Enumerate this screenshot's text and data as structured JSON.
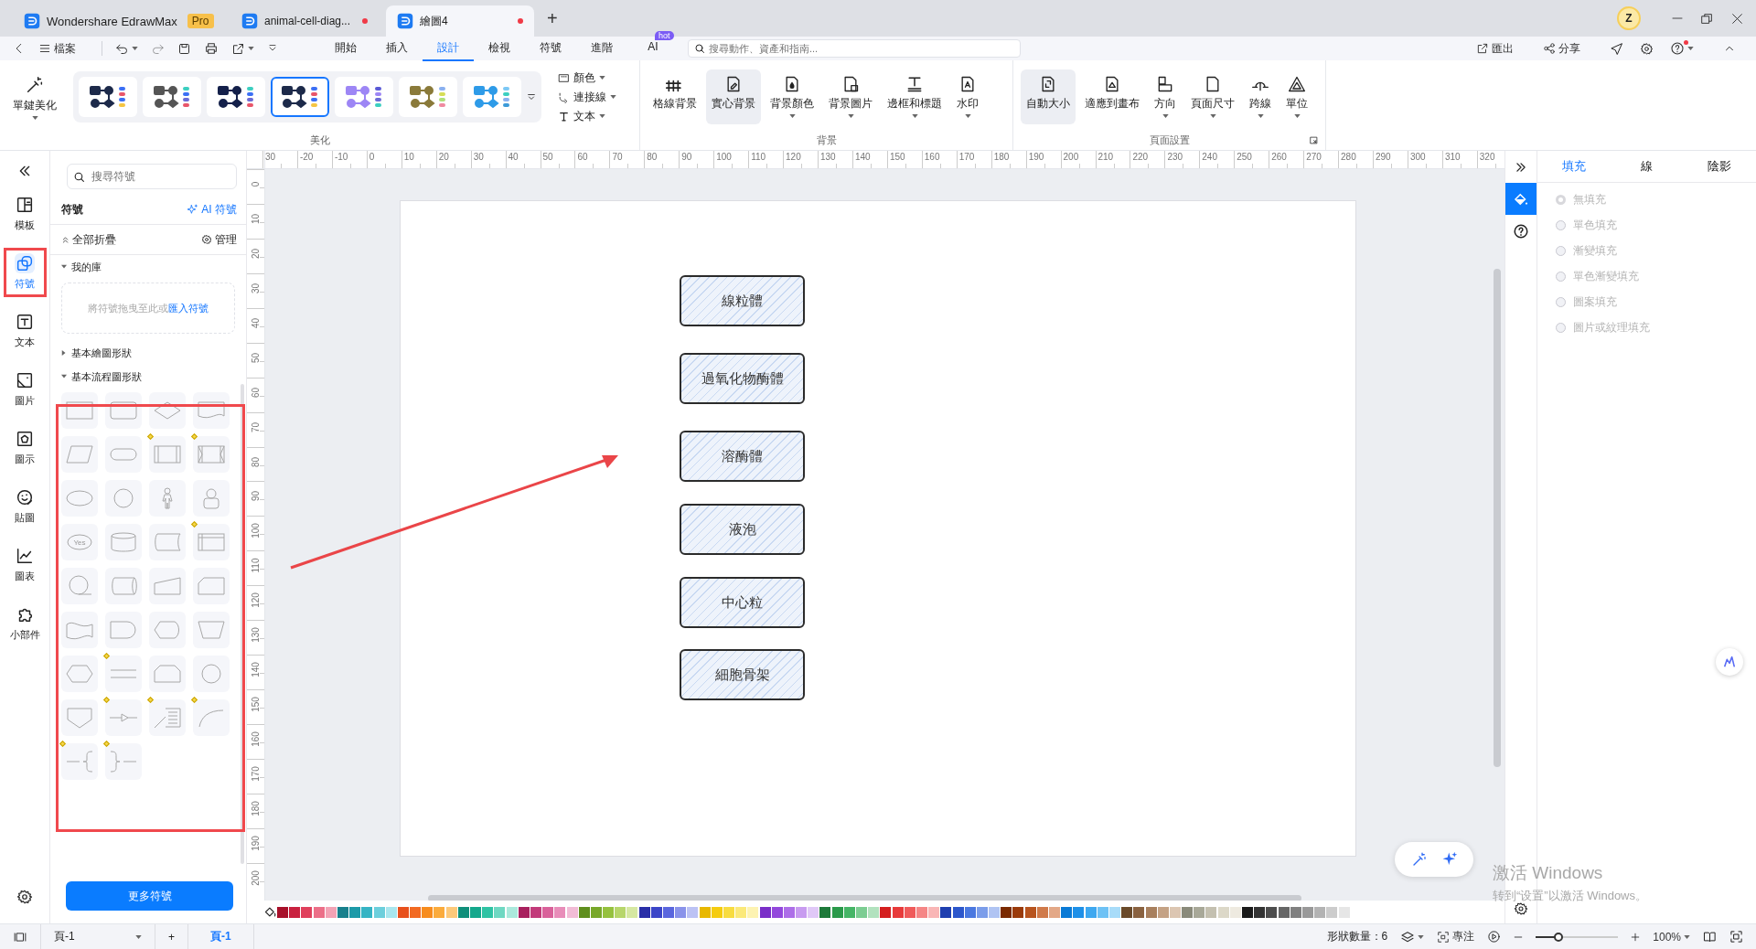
{
  "title_bar": {
    "tabs": [
      {
        "kind": "app",
        "label": "Wondershare EdrawMax",
        "badge": "Pro",
        "selected": false,
        "unsaved": false
      },
      {
        "kind": "doc",
        "label": "animal-cell-diag...",
        "selected": false,
        "unsaved": true
      },
      {
        "kind": "doc",
        "label": "繪圖4",
        "selected": true,
        "unsaved": true
      }
    ],
    "new_tab": "+",
    "avatar": "Z"
  },
  "menu_bar": {
    "file": "檔案",
    "tabs": [
      {
        "label": "開始",
        "selected": false
      },
      {
        "label": "插入",
        "selected": false
      },
      {
        "label": "設計",
        "selected": true
      },
      {
        "label": "檢視",
        "selected": false
      },
      {
        "label": "符號",
        "selected": false
      },
      {
        "label": "進階",
        "selected": false
      },
      {
        "label": "AI",
        "selected": false,
        "badge": "hot"
      }
    ],
    "search": {
      "placeholder": "搜尋動作、資產和指南..."
    },
    "export": "匯出",
    "share": "分享",
    "help_notification": true
  },
  "ribbon": {
    "groups": [
      {
        "kind": "beautify",
        "label": "美化",
        "beautify_button": "單鍵美化",
        "styles": [
          {
            "color": "#1d2a4a",
            "selected": false
          },
          {
            "color": "#555555",
            "selected": false
          },
          {
            "color": "#14204a",
            "selected": false
          },
          {
            "color": "#1d2a4a",
            "selected": true
          },
          {
            "color": "#9d86f5",
            "selected": false
          },
          {
            "color": "#8a7a3a",
            "selected": false
          },
          {
            "color": "#2e9be8",
            "selected": false
          }
        ],
        "format_menus": [
          {
            "label": "顏色"
          },
          {
            "label": "連接線"
          },
          {
            "label": "文本"
          }
        ]
      },
      {
        "kind": "buttons",
        "label": "背景",
        "buttons": [
          {
            "label": "格線背景",
            "caret": false,
            "selected": false
          },
          {
            "label": "實心背景",
            "caret": false,
            "selected": true
          },
          {
            "label": "背景顏色",
            "caret": true,
            "selected": false
          },
          {
            "label": "背景圖片",
            "caret": true,
            "selected": false
          },
          {
            "label": "邊框和標題",
            "caret": true,
            "selected": false
          },
          {
            "label": "水印",
            "caret": true,
            "selected": false
          }
        ]
      },
      {
        "kind": "buttons",
        "label": "頁面設置",
        "launcher": true,
        "buttons": [
          {
            "label": "自動大小",
            "caret": false,
            "selected": true
          },
          {
            "label": "適應到畫布",
            "caret": false,
            "selected": false
          },
          {
            "label": "方向",
            "caret": true,
            "selected": false
          },
          {
            "label": "頁面尺寸",
            "caret": true,
            "selected": false
          },
          {
            "label": "跨線",
            "caret": true,
            "selected": false
          },
          {
            "label": "單位",
            "caret": true,
            "selected": false
          }
        ]
      }
    ]
  },
  "left_rail": {
    "items": [
      {
        "label": "模板",
        "selected": false
      },
      {
        "label": "符號",
        "selected": true
      },
      {
        "label": "文本",
        "selected": false
      },
      {
        "label": "圖片",
        "selected": false
      },
      {
        "label": "圖示",
        "selected": false
      },
      {
        "label": "貼圖",
        "selected": false
      },
      {
        "label": "圖表",
        "selected": false
      },
      {
        "label": "小部件",
        "selected": false
      }
    ]
  },
  "symbol_panel": {
    "search": {
      "placeholder": "搜尋符號"
    },
    "title": "符號",
    "ai_link": "AI 符號",
    "collapse_all": "全部折疊",
    "manage": "管理",
    "libraries": [
      {
        "name": "我的庫",
        "expanded": true,
        "drop_hint": "將符號拖曳至此或",
        "import_link": "匯入符號"
      },
      {
        "name": "基本繪圖形狀",
        "expanded": false
      },
      {
        "name": "基本流程圖形狀",
        "expanded": true,
        "shapes": [
          {
            "kind": "rect"
          },
          {
            "kind": "rounded"
          },
          {
            "kind": "diamond"
          },
          {
            "kind": "document"
          },
          {
            "kind": "parallelogram"
          },
          {
            "kind": "terminator"
          },
          {
            "kind": "predefined",
            "handle": true
          },
          {
            "kind": "predefined-x",
            "handle": true
          },
          {
            "kind": "ellipse"
          },
          {
            "kind": "circle"
          },
          {
            "kind": "person"
          },
          {
            "kind": "user"
          },
          {
            "kind": "bubble",
            "label": "Yes"
          },
          {
            "kind": "cylinder"
          },
          {
            "kind": "stored"
          },
          {
            "kind": "window",
            "handle": true
          },
          {
            "kind": "tail-circle"
          },
          {
            "kind": "drum"
          },
          {
            "kind": "manual-input"
          },
          {
            "kind": "card"
          },
          {
            "kind": "tape"
          },
          {
            "kind": "delay"
          },
          {
            "kind": "display"
          },
          {
            "kind": "trapezoid"
          },
          {
            "kind": "hexagon"
          },
          {
            "kind": "lines",
            "handle": true
          },
          {
            "kind": "loop-limit"
          },
          {
            "kind": "circle"
          },
          {
            "kind": "offpage"
          },
          {
            "kind": "line-arrow",
            "handle": true
          },
          {
            "kind": "note",
            "handle": true
          },
          {
            "kind": "arc",
            "handle": true
          },
          {
            "kind": "brace-left",
            "handle": true
          },
          {
            "kind": "brace-right",
            "handle": true
          }
        ]
      }
    ],
    "more_button": "更多符號"
  },
  "canvas": {
    "rulers": {
      "horizontal": [
        "30",
        "-20",
        "-10",
        "0",
        "10",
        "20",
        "30",
        "40",
        "50",
        "60",
        "70",
        "80",
        "90",
        "100",
        "110",
        "120",
        "130",
        "140",
        "150",
        "160",
        "170",
        "180",
        "190",
        "200",
        "210",
        "220",
        "230",
        "240",
        "250",
        "260",
        "270",
        "280",
        "290",
        "300",
        "310",
        "320"
      ],
      "vertical": [
        "0",
        "10",
        "20",
        "30",
        "40",
        "50",
        "60",
        "70",
        "80",
        "90",
        "100",
        "110",
        "120",
        "130",
        "140",
        "150",
        "160",
        "170",
        "180",
        "190",
        "200"
      ]
    },
    "shapes": [
      {
        "label": "線粒體"
      },
      {
        "label": "過氧化物酶體"
      },
      {
        "label": "溶酶體"
      },
      {
        "label": "液泡"
      },
      {
        "label": "中心粒"
      },
      {
        "label": "細胞骨架"
      }
    ]
  },
  "palette": [
    {
      "color": "#a8102a"
    },
    {
      "color": "#c9213f"
    },
    {
      "color": "#e0405c"
    },
    {
      "color": "#ec6f88"
    },
    {
      "color": "#f3a3b5"
    },
    {
      "color": "#17808c"
    },
    {
      "color": "#1c9aa8"
    },
    {
      "color": "#35b4c4"
    },
    {
      "color": "#6ccfdc"
    },
    {
      "color": "#a8e6ee"
    },
    {
      "color": "#e8501c"
    },
    {
      "color": "#f26a22"
    },
    {
      "color": "#f78c1e"
    },
    {
      "color": "#fbab3c"
    },
    {
      "color": "#fdc97a"
    },
    {
      "color": "#0f8f7a"
    },
    {
      "color": "#14a88c"
    },
    {
      "color": "#2fc3a4"
    },
    {
      "color": "#6fd8c2"
    },
    {
      "color": "#abe9dc"
    },
    {
      "color": "#a8205e"
    },
    {
      "color": "#c23a7a"
    },
    {
      "color": "#d9619a"
    },
    {
      "color": "#e88db9"
    },
    {
      "color": "#f2bcd6"
    },
    {
      "color": "#5f8f1e"
    },
    {
      "color": "#78a82a"
    },
    {
      "color": "#95c13e"
    },
    {
      "color": "#b7d66b"
    },
    {
      "color": "#d6e8a2"
    },
    {
      "color": "#2a2fa8"
    },
    {
      "color": "#3b45c8"
    },
    {
      "color": "#5a66de"
    },
    {
      "color": "#8a93ea"
    },
    {
      "color": "#bcc2f4"
    },
    {
      "color": "#e8b800"
    },
    {
      "color": "#f5cc10"
    },
    {
      "color": "#f8dc40"
    },
    {
      "color": "#fbe97a"
    },
    {
      "color": "#fdf3b2"
    },
    {
      "color": "#7a2fc8"
    },
    {
      "color": "#9348dc"
    },
    {
      "color": "#ad6ee8"
    },
    {
      "color": "#c89bf0"
    },
    {
      "color": "#e0c8f7"
    },
    {
      "color": "#1e7a3a"
    },
    {
      "color": "#2a9a4a"
    },
    {
      "color": "#45b566"
    },
    {
      "color": "#7ccd92"
    },
    {
      "color": "#b2e2be"
    },
    {
      "color": "#d41f1f"
    },
    {
      "color": "#e83a3a"
    },
    {
      "color": "#f05a5a"
    },
    {
      "color": "#f58686"
    },
    {
      "color": "#f9b6b6"
    },
    {
      "color": "#1f3fb0"
    },
    {
      "color": "#2c57cc"
    },
    {
      "color": "#4a78e0"
    },
    {
      "color": "#7b9dea"
    },
    {
      "color": "#b0c4f3"
    },
    {
      "color": "#7a2a00"
    },
    {
      "color": "#9a3a0a"
    },
    {
      "color": "#b8541e"
    },
    {
      "color": "#d07a4a"
    },
    {
      "color": "#e3a887"
    },
    {
      "color": "#0a7ad6"
    },
    {
      "color": "#1e90e8"
    },
    {
      "color": "#3ea8f0"
    },
    {
      "color": "#6ec2f5"
    },
    {
      "color": "#a8dcf9"
    },
    {
      "color": "#6a4a2a"
    },
    {
      "color": "#8a6240"
    },
    {
      "color": "#a8805e"
    },
    {
      "color": "#c4a285"
    },
    {
      "color": "#dcc6b2"
    },
    {
      "color": "#8a8a7a"
    },
    {
      "color": "#a8a898"
    },
    {
      "color": "#c4c0b0"
    },
    {
      "color": "#dcd8c8"
    },
    {
      "color": "#eeeae0"
    },
    {
      "color": "#1a1a1a"
    },
    {
      "color": "#333333"
    },
    {
      "color": "#4d4d4d"
    },
    {
      "color": "#666666"
    },
    {
      "color": "#808080"
    },
    {
      "color": "#999999"
    },
    {
      "color": "#b3b3b3"
    },
    {
      "color": "#cccccc"
    },
    {
      "color": "#e6e6e6"
    }
  ],
  "right_rail": {
    "items": [
      {
        "kind": "fill",
        "selected": true
      },
      {
        "kind": "help",
        "selected": false
      }
    ]
  },
  "format_panel": {
    "tabs": [
      {
        "label": "填充",
        "selected": true
      },
      {
        "label": "線",
        "selected": false
      },
      {
        "label": "陰影",
        "selected": false
      }
    ],
    "disabled": true,
    "options": [
      {
        "label": "無填充",
        "selected": true
      },
      {
        "label": "單色填充",
        "selected": false
      },
      {
        "label": "漸變填充",
        "selected": false
      },
      {
        "label": "單色漸變填充",
        "selected": false
      },
      {
        "label": "圖案填充",
        "selected": false
      },
      {
        "label": "圖片或紋理填充",
        "selected": false
      }
    ]
  },
  "activation_notice": {
    "title": "激活 Windows",
    "hint": "转到“设置”以激活 Windows。"
  },
  "status_bar": {
    "page_select": "頁-1",
    "add_page": "+",
    "pages": [
      {
        "label": "頁-1",
        "selected": true
      }
    ],
    "shape_count": "形狀數量：6",
    "focus": "專注",
    "zoom": {
      "level": 0.28,
      "reading": "100%"
    }
  }
}
